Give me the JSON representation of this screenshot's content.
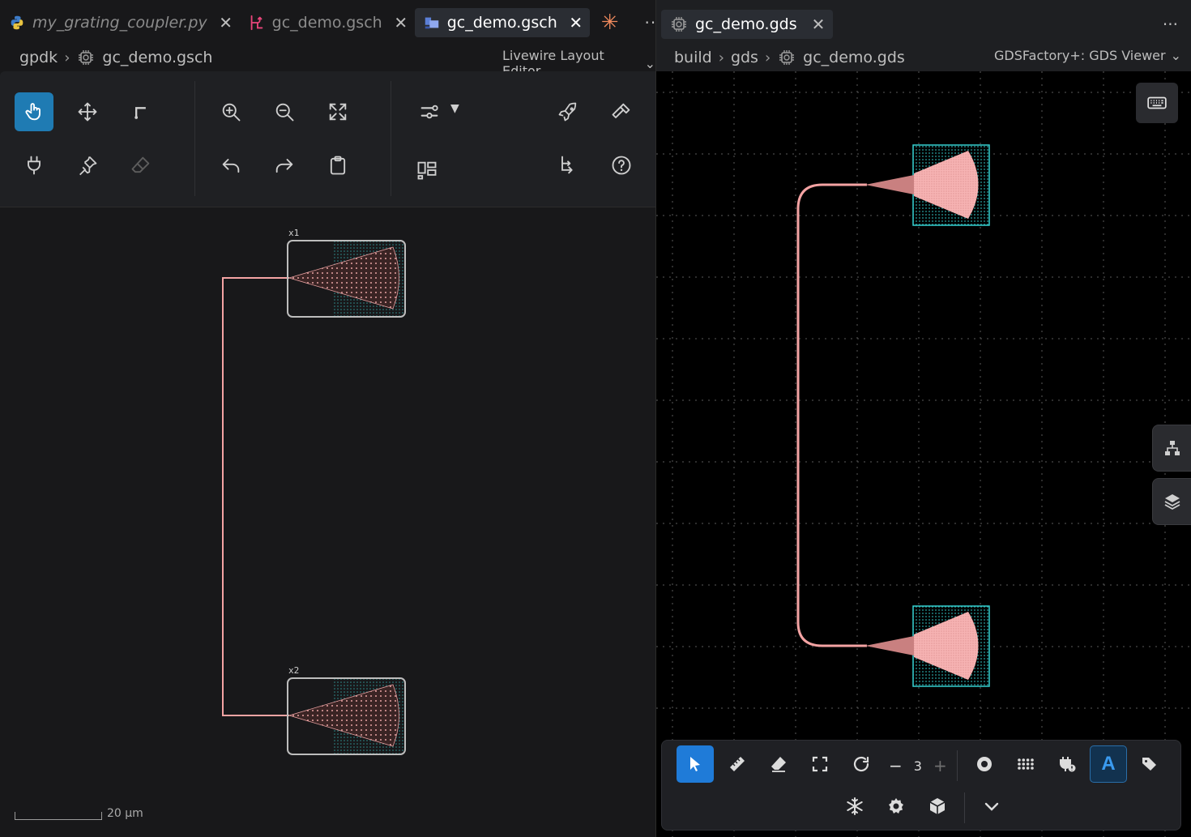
{
  "left_tabs": [
    {
      "label": "my_grating_coupler.py",
      "icon": "python-icon",
      "italic": true,
      "active": false
    },
    {
      "label": "gc_demo.gsch",
      "icon": "schematic-icon",
      "italic": false,
      "active": false
    },
    {
      "label": "gc_demo.gsch",
      "icon": "layout-icon",
      "italic": false,
      "active": true
    }
  ],
  "left_breadcrumb": {
    "root": "gpdk",
    "file": "gc_demo.gsch"
  },
  "left_editor_mode": "Livewire Layout Editor",
  "instances": [
    {
      "label": "x1"
    },
    {
      "label": "x2"
    }
  ],
  "scale_label": "20 µm",
  "right_tab": {
    "label": "gc_demo.gds",
    "icon": "chip-icon"
  },
  "right_breadcrumb": {
    "a": "build",
    "b": "gds",
    "file": "gc_demo.gds"
  },
  "right_viewer_mode": "GDSFactory+: GDS Viewer",
  "bottom_bar": {
    "step_value": "3",
    "minus": "−",
    "plus": "+"
  },
  "colors": {
    "accent": "#1f7bb3",
    "waveguide": "#f4a3a3",
    "cyan": "#35d0d0",
    "active_blue": "#1f7bd8"
  }
}
